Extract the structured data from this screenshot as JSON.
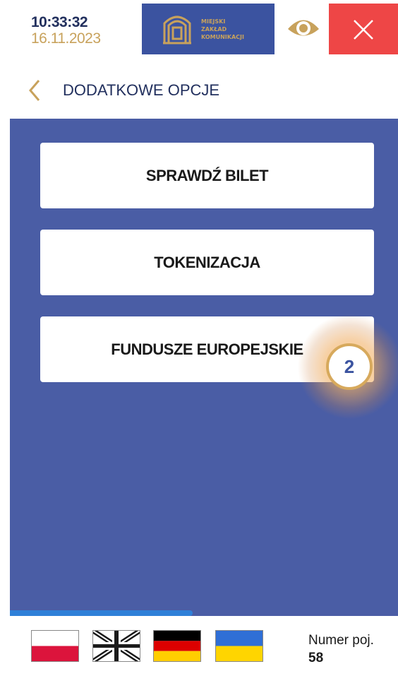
{
  "header": {
    "time": "10:33:32",
    "date": "16.11.2023",
    "logo_line1": "MIEJSKI",
    "logo_line2": "ZAKŁAD",
    "logo_line3": "KOMUNIKACJI",
    "eye_icon": "eye-icon",
    "close_icon": "close-icon"
  },
  "titlebar": {
    "back_icon": "chevron-left-icon",
    "title": "DODATKOWE OPCJE"
  },
  "options": [
    {
      "label": "SPRAWDŹ BILET"
    },
    {
      "label": "TOKENIZACJA"
    },
    {
      "label": "FUNDUSZE EUROPEJSKIE"
    }
  ],
  "badge": {
    "value": "2"
  },
  "progress": {
    "fraction": 0.47
  },
  "footer": {
    "languages": [
      "pl-flag-icon",
      "gb-flag-icon",
      "de-flag-icon",
      "ua-flag-icon"
    ],
    "number_label": "Numer poj.",
    "number_value": "58"
  },
  "colors": {
    "brand_blue": "#4a5da5",
    "logo_blue": "#3b53a0",
    "gold": "#c8a25c",
    "close_red": "#ee4646",
    "progress": "#2f80d8"
  }
}
